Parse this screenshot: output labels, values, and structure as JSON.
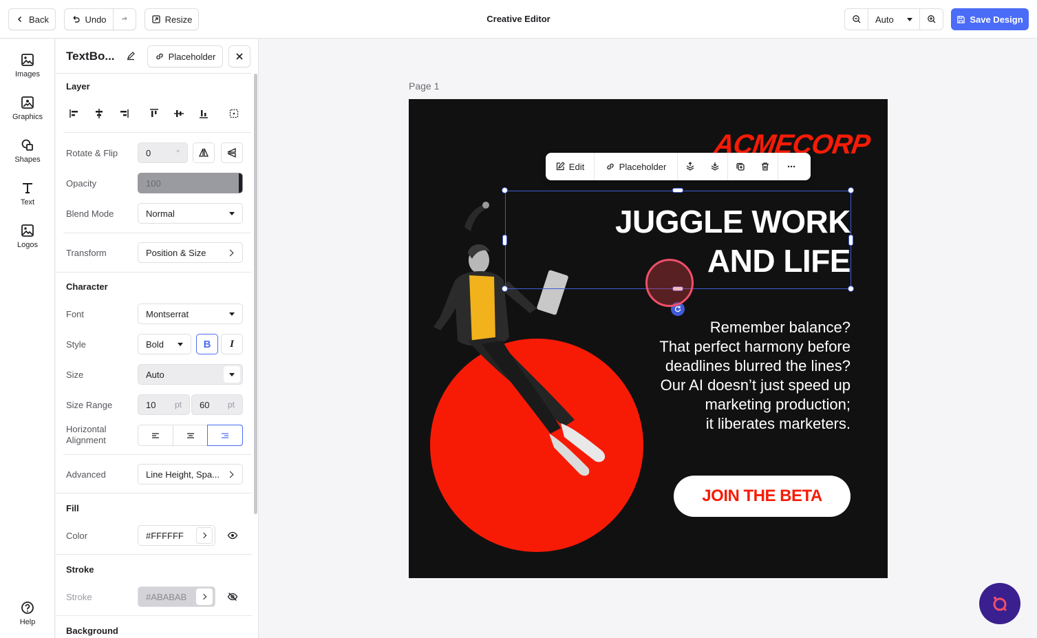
{
  "topbar": {
    "back_label": "Back",
    "undo_label": "Undo",
    "resize_label": "Resize",
    "title": "Creative Editor",
    "zoom_value": "Auto",
    "save_label": "Save Design"
  },
  "dock": {
    "items": [
      {
        "label": "Images",
        "icon": "image-icon"
      },
      {
        "label": "Graphics",
        "icon": "graphics-icon"
      },
      {
        "label": "Shapes",
        "icon": "shapes-icon"
      },
      {
        "label": "Text",
        "icon": "text-icon"
      },
      {
        "label": "Logos",
        "icon": "logos-icon"
      }
    ],
    "help_label": "Help"
  },
  "panel": {
    "title": "TextBo...",
    "placeholder_label": "Placeholder",
    "layer": {
      "heading": "Layer",
      "rotate_label": "Rotate & Flip",
      "rotate_value": "0",
      "rotate_unit": "°",
      "opacity_label": "Opacity",
      "opacity_value": "100",
      "blend_label": "Blend Mode",
      "blend_value": "Normal",
      "transform_label": "Transform",
      "transform_value": "Position & Size"
    },
    "character": {
      "heading": "Character",
      "font_label": "Font",
      "font_value": "Montserrat",
      "style_label": "Style",
      "style_value": "Bold",
      "bold_glyph": "B",
      "italic_glyph": "I",
      "size_label": "Size",
      "size_value": "Auto",
      "range_label": "Size Range",
      "range_min": "10",
      "range_max": "60",
      "range_unit": "pt",
      "halign_label_1": "Horizontal",
      "halign_label_2": "Alignment",
      "advanced_label": "Advanced",
      "advanced_value": "Line Height, Spa..."
    },
    "fill": {
      "heading": "Fill",
      "color_label": "Color",
      "color_value": "#FFFFFF"
    },
    "stroke": {
      "heading": "Stroke",
      "stroke_label": "Stroke",
      "stroke_value": "#ABABAB"
    },
    "background": {
      "heading": "Background"
    }
  },
  "canvas": {
    "page_label": "Page 1",
    "logo_text": "ACMECORP",
    "headline_1": "JUGGLE WORK",
    "headline_2": "AND LIFE",
    "body_lines": [
      "Remember balance?",
      "That perfect harmony before",
      "deadlines blurred the lines?",
      "Our AI doesn’t just speed up",
      "marketing production;",
      "it liberates marketers."
    ],
    "cta_label": "JOIN THE BETA",
    "colors": {
      "accent": "#F71B06",
      "background": "#111111",
      "selection": "#3F5BD9",
      "primary_button": "#4A6CF7"
    }
  },
  "floating_toolbar": {
    "edit_label": "Edit",
    "placeholder_label": "Placeholder"
  }
}
